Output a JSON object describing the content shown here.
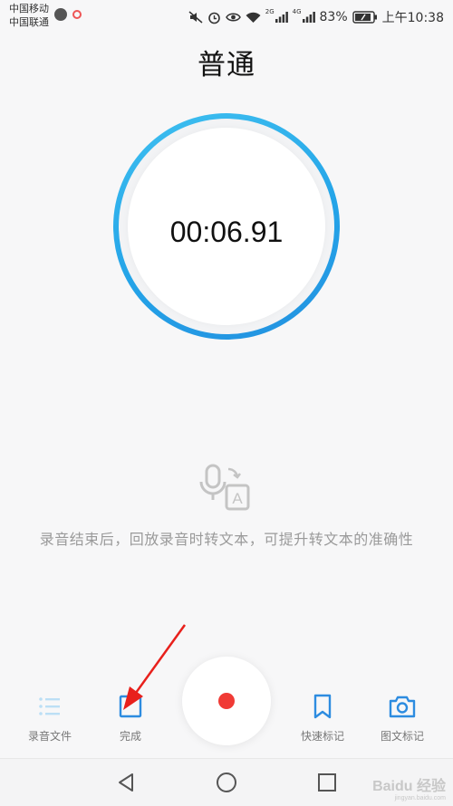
{
  "status_bar": {
    "carrier1": "中国移动",
    "carrier2": "中国联通",
    "network1": "2G",
    "network2": "4G",
    "battery": "83%",
    "time": "上午10:38"
  },
  "mode_title": "普通",
  "timer": "00:06.91",
  "hint": "录音结束后，回放录音时转文本，可提升转文本的准确性",
  "controls": {
    "recordings_label": "录音文件",
    "done_label": "完成",
    "quick_mark_label": "快速标记",
    "photo_mark_label": "图文标记"
  },
  "colors": {
    "ring_gradient_start": "#3fc0f0",
    "ring_gradient_end": "#2391e0",
    "accent_blue": "#2d8ce0",
    "record_red": "#f03a35",
    "annotation_red": "#e8201c"
  },
  "watermark": {
    "main": "Baidu 经验",
    "sub": "jingyan.baidu.com"
  }
}
